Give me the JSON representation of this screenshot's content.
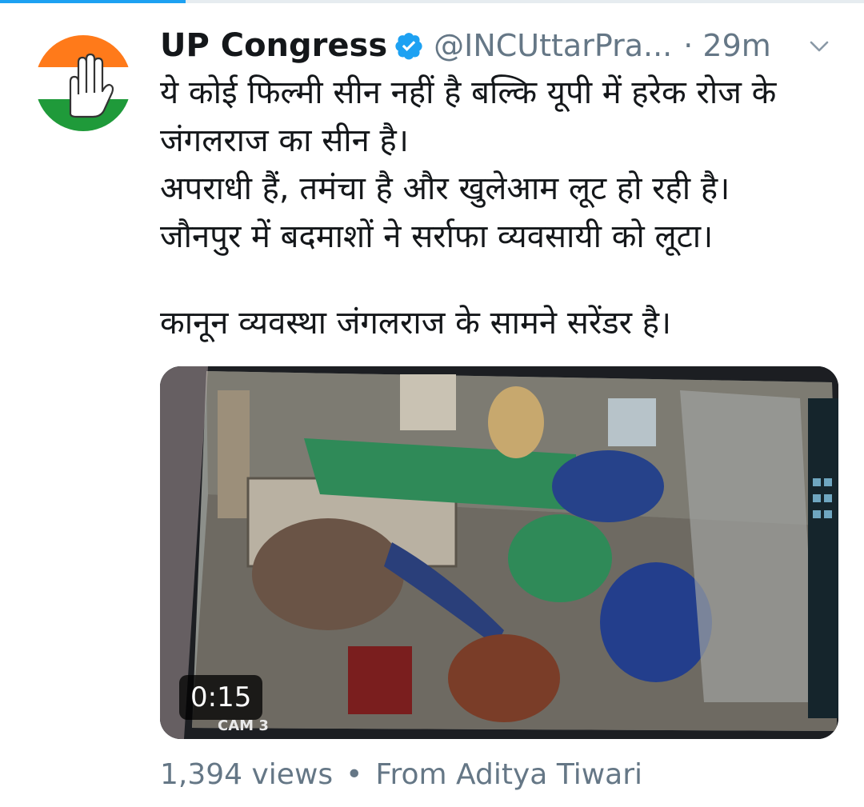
{
  "tweet": {
    "display_name": "UP Congress",
    "handle": "@INCUttarPra...",
    "time": "· 29m",
    "text_lines": [
      "ये कोई फिल्मी सीन नहीं है बल्कि यूपी में हरेक रोज के",
      "जंगलराज का सीन है।",
      "अपराधी हैं, तमंचा है और खुलेआम लूट हो रही है।",
      "जौनपुर में बदमाशों ने सर्राफा व्यवसायी को लूटा।"
    ],
    "text_last": "कानून व्यवस्था जंगलराज के सामने सरेंडर है।"
  },
  "media": {
    "duration": "0:15",
    "cam_label": "CAM 3"
  },
  "footer": {
    "views": "1,394 views",
    "separator": "•",
    "source": "From Aditya Tiwari"
  },
  "colors": {
    "accent": "#1da1f2",
    "secondary_text": "#657786",
    "primary_text": "#14171a",
    "logo_saffron": "#ff7a1a",
    "logo_green": "#1f9a3a"
  },
  "icons": {
    "verified": "verified-badge-icon",
    "caret": "chevron-down-icon",
    "avatar": "congress-hand-logo"
  }
}
